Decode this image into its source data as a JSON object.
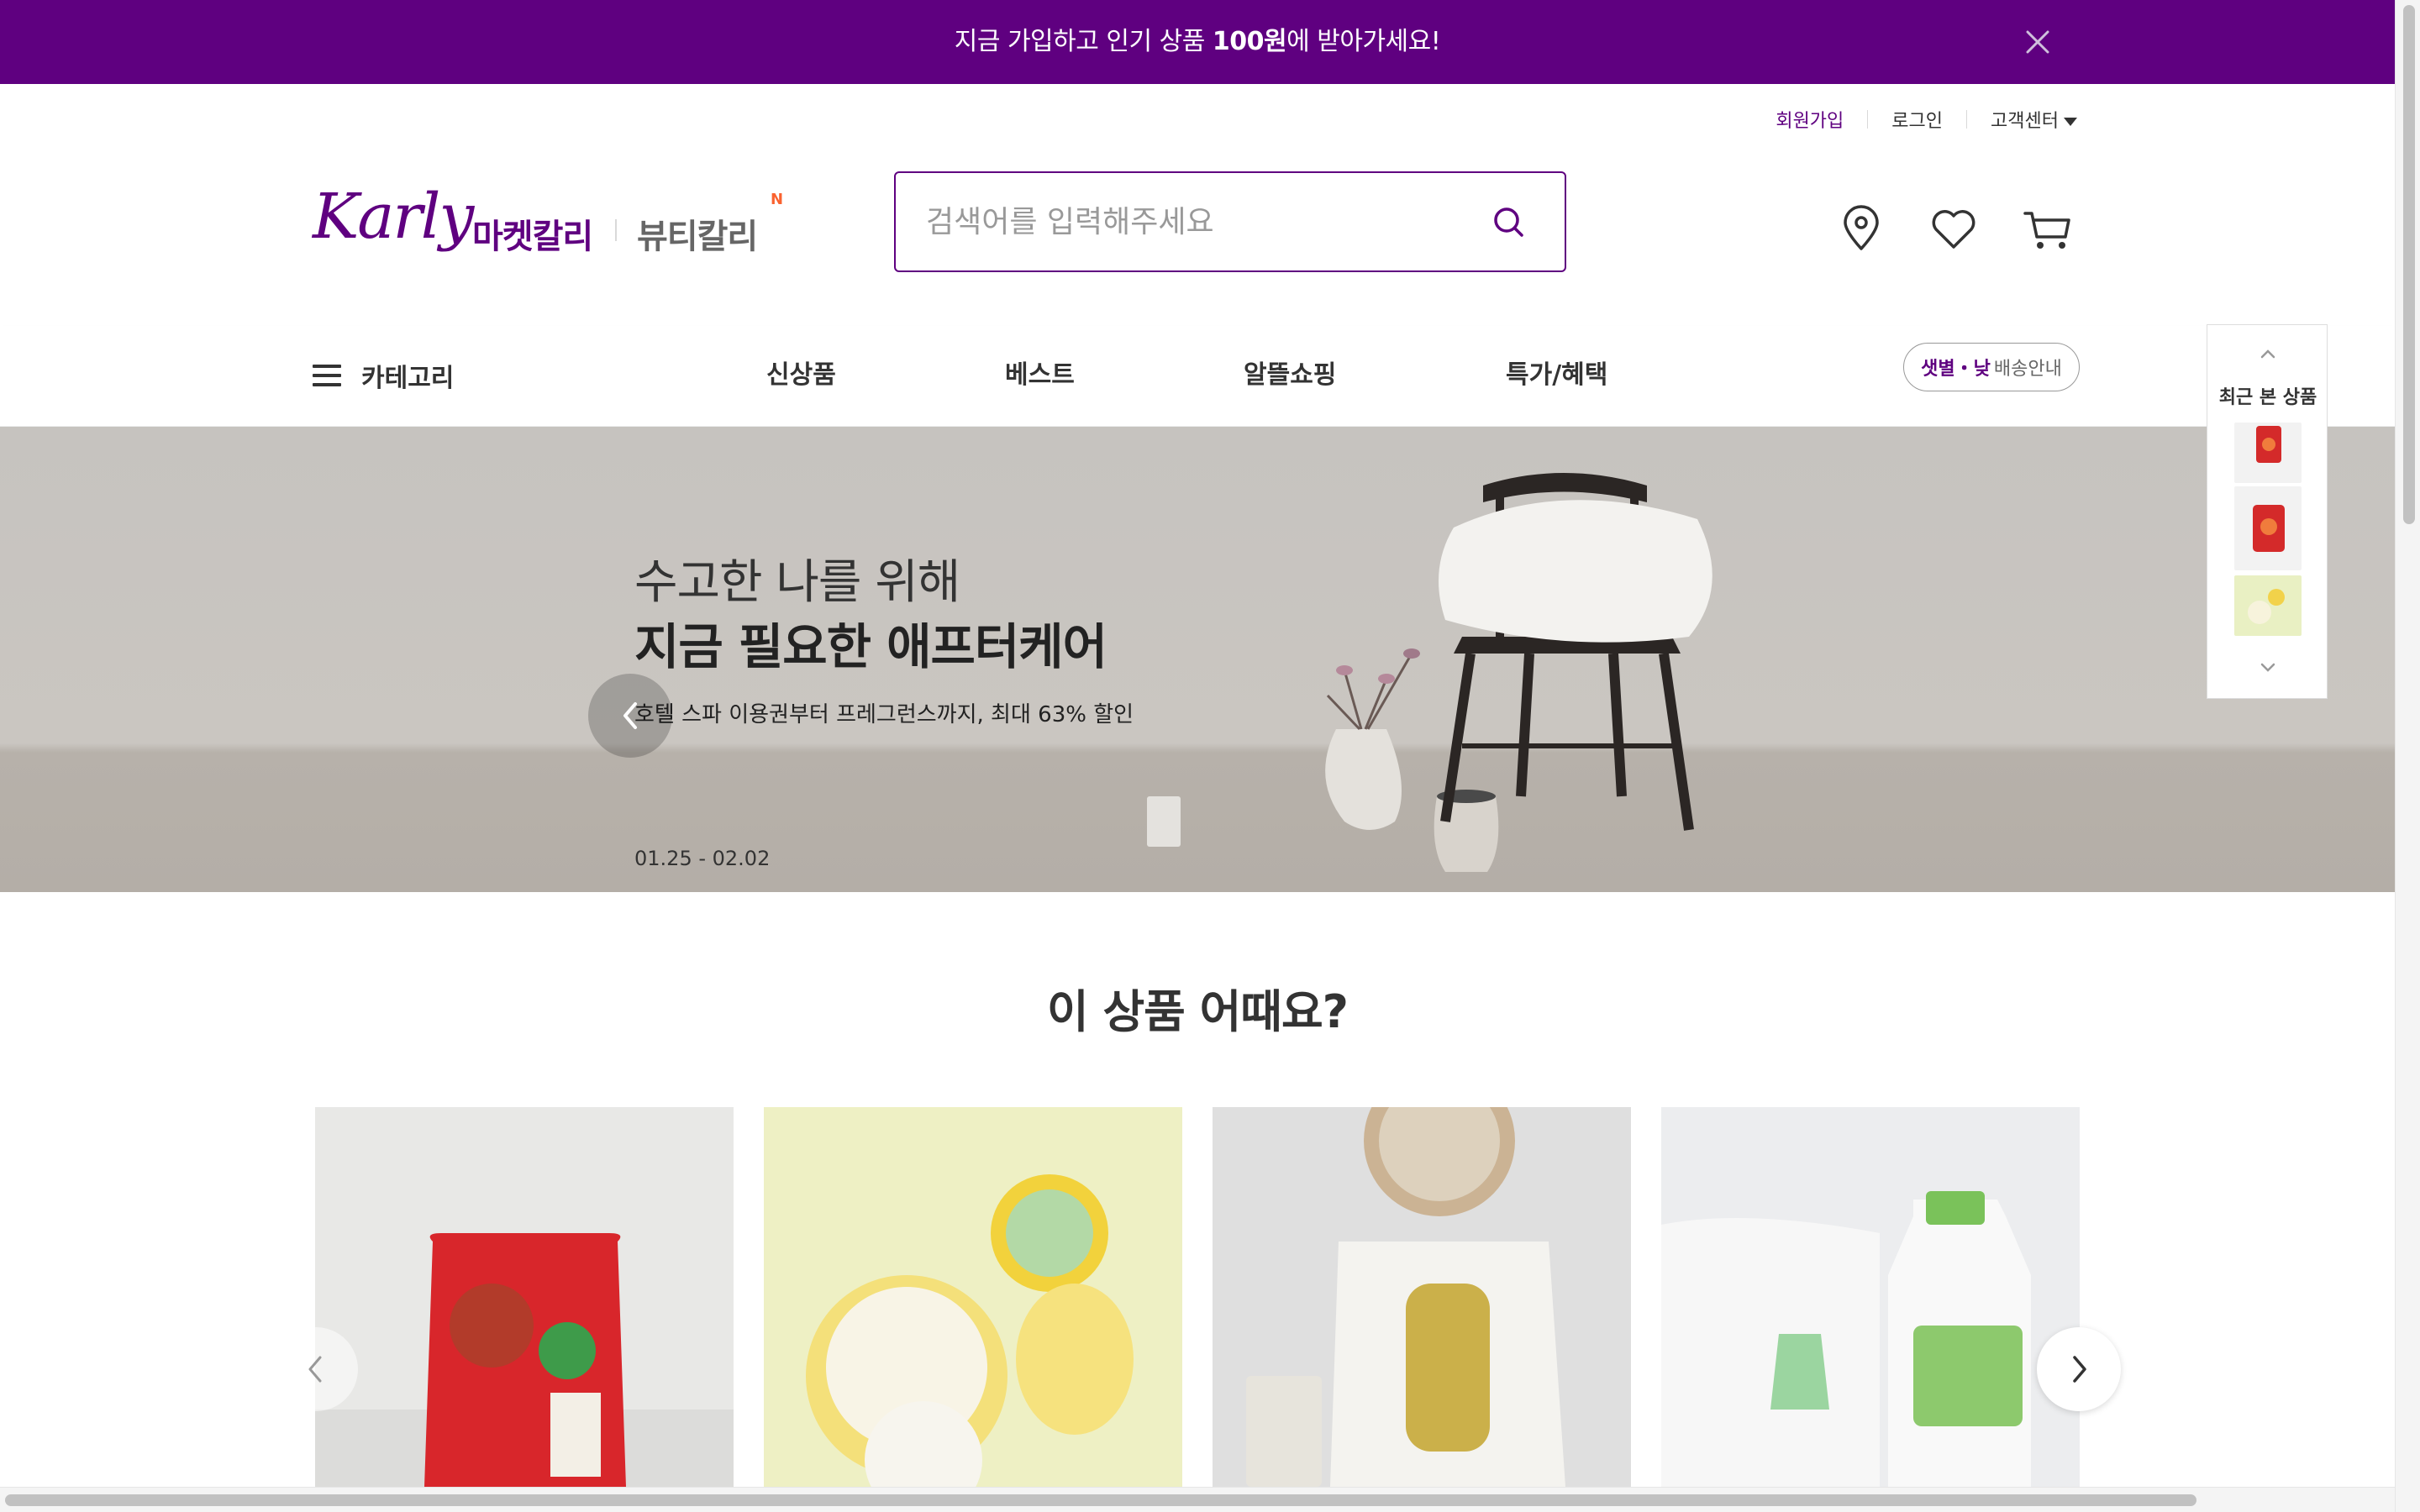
{
  "promo": {
    "text_before": "지금 가입하고 인기 상품 ",
    "text_bold": "100원",
    "text_after": "에 받아가세요!"
  },
  "util": {
    "signup": "회원가입",
    "login": "로그인",
    "customer_center": "고객센터"
  },
  "logo": {
    "script": "Karly",
    "market": "마켓칼리",
    "beauty": "뷰티칼리",
    "new_badge": "N"
  },
  "search": {
    "placeholder": "검색어를 입력해주세요"
  },
  "gnb": {
    "category": "카테고리",
    "menu": [
      "신상품",
      "베스트",
      "알뜰쇼핑",
      "특가/혜택"
    ],
    "delivery_highlight": "샛별・낮",
    "delivery_rest": "배송안내"
  },
  "hero": {
    "subtitle": "수고한 나를 위해",
    "title": "지금 필요한 애프터케어",
    "description": "호텔 스파 이용권부터 프레그런스까지, 최대 63% 할인",
    "date": "01.25 - 02.02"
  },
  "recent": {
    "title": "최근 본 상품"
  },
  "section": {
    "title": "이 상품 어때요?"
  },
  "colors": {
    "brand": "#5f0080",
    "new_badge": "#fa622f"
  },
  "icons": [
    "close-icon",
    "search-icon",
    "location-icon",
    "heart-icon",
    "cart-icon",
    "hamburger-icon",
    "chevron-left-icon",
    "chevron-right-icon",
    "chevron-up-icon",
    "chevron-down-icon"
  ]
}
